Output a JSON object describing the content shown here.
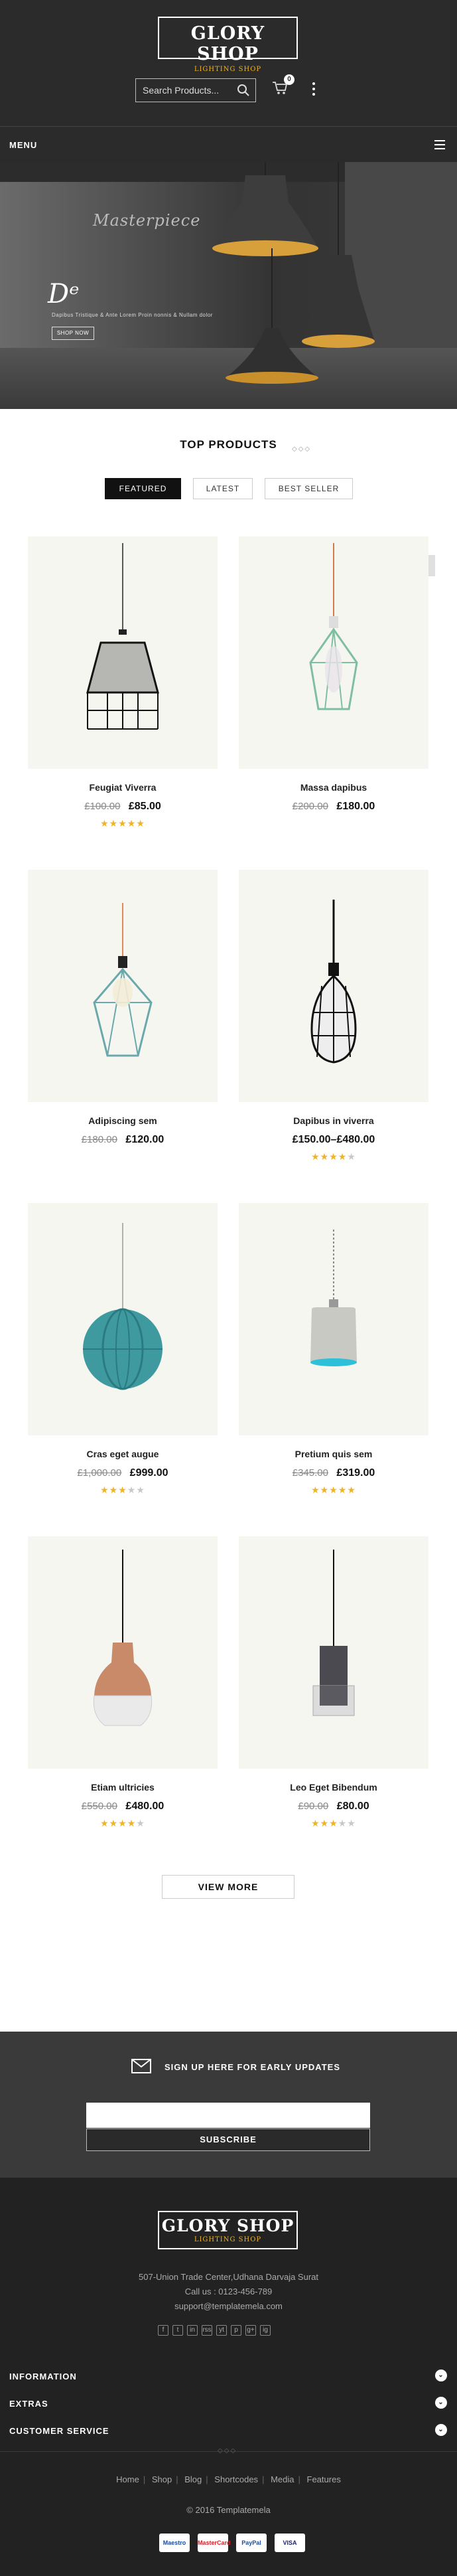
{
  "header": {
    "logo_title": "GLORY SHOP",
    "logo_subtitle": "LIGHTING SHOP",
    "search_placeholder": "Search Products...",
    "cart_count": "0"
  },
  "menu": {
    "label": "MENU"
  },
  "banner": {
    "tagline": "Masterpiece",
    "script": "Dᵉ",
    "subtext": "Dapibus Tristique & Ante Lorem Proin nonnis & Nullam dolor",
    "cta": "SHOP NOW"
  },
  "top_products": {
    "title": "TOP PRODUCTS",
    "tabs": [
      {
        "label": "FEATURED",
        "active": true
      },
      {
        "label": "LATEST",
        "active": false
      },
      {
        "label": "BEST SELLER",
        "active": false
      }
    ],
    "scroll_top": "^",
    "products": [
      {
        "name": "Feugiat Viverra",
        "old_price": "£100.00",
        "price": "£85.00",
        "rating": 5
      },
      {
        "name": "Massa dapibus",
        "old_price": "£200.00",
        "price": "£180.00",
        "rating": 0
      },
      {
        "name": "Adipiscing sem",
        "old_price": "£180.00",
        "price": "£120.00",
        "rating": 0
      },
      {
        "name": "Dapibus in viverra",
        "old_price": "",
        "price": "£150.00–£480.00",
        "rating": 4
      },
      {
        "name": "Cras eget augue",
        "old_price": "£1,000.00",
        "price": "£999.00",
        "rating": 3
      },
      {
        "name": "Pretium quis sem",
        "old_price": "£345.00",
        "price": "£319.00",
        "rating": 5
      },
      {
        "name": "Etiam ultricies",
        "old_price": "£550.00",
        "price": "£480.00",
        "rating": 4
      },
      {
        "name": "Leo Eget Bibendum",
        "old_price": "£90.00",
        "price": "£80.00",
        "rating": 3
      }
    ],
    "view_more": "VIEW MORE"
  },
  "newsletter": {
    "title": "SIGN UP HERE FOR EARLY UPDATES",
    "button": "SUBSCRIBE"
  },
  "footer": {
    "logo_title": "GLORY SHOP",
    "logo_subtitle": "LIGHTING SHOP",
    "address": "507-Union Trade Center,Udhana Darvaja Surat",
    "phone": "Call us : 0123-456-789",
    "email": "support@templatemela.com",
    "social": [
      "f",
      "t",
      "in",
      "rss",
      "yt",
      "p",
      "g+",
      "ig"
    ],
    "accordions": [
      "INFORMATION",
      "EXTRAS",
      "CUSTOMER SERVICE"
    ],
    "links": [
      "Home",
      "Shop",
      "Blog",
      "Shortcodes",
      "Media",
      "Features"
    ],
    "copyright": "© 2016 Templatemela",
    "payments": [
      "Maestro",
      "MasterCard",
      "PayPal",
      "VISA"
    ]
  },
  "colors": {
    "accent": "#f0b322",
    "dark": "#2b2b2b",
    "product_bg": "#f6f6f1"
  }
}
